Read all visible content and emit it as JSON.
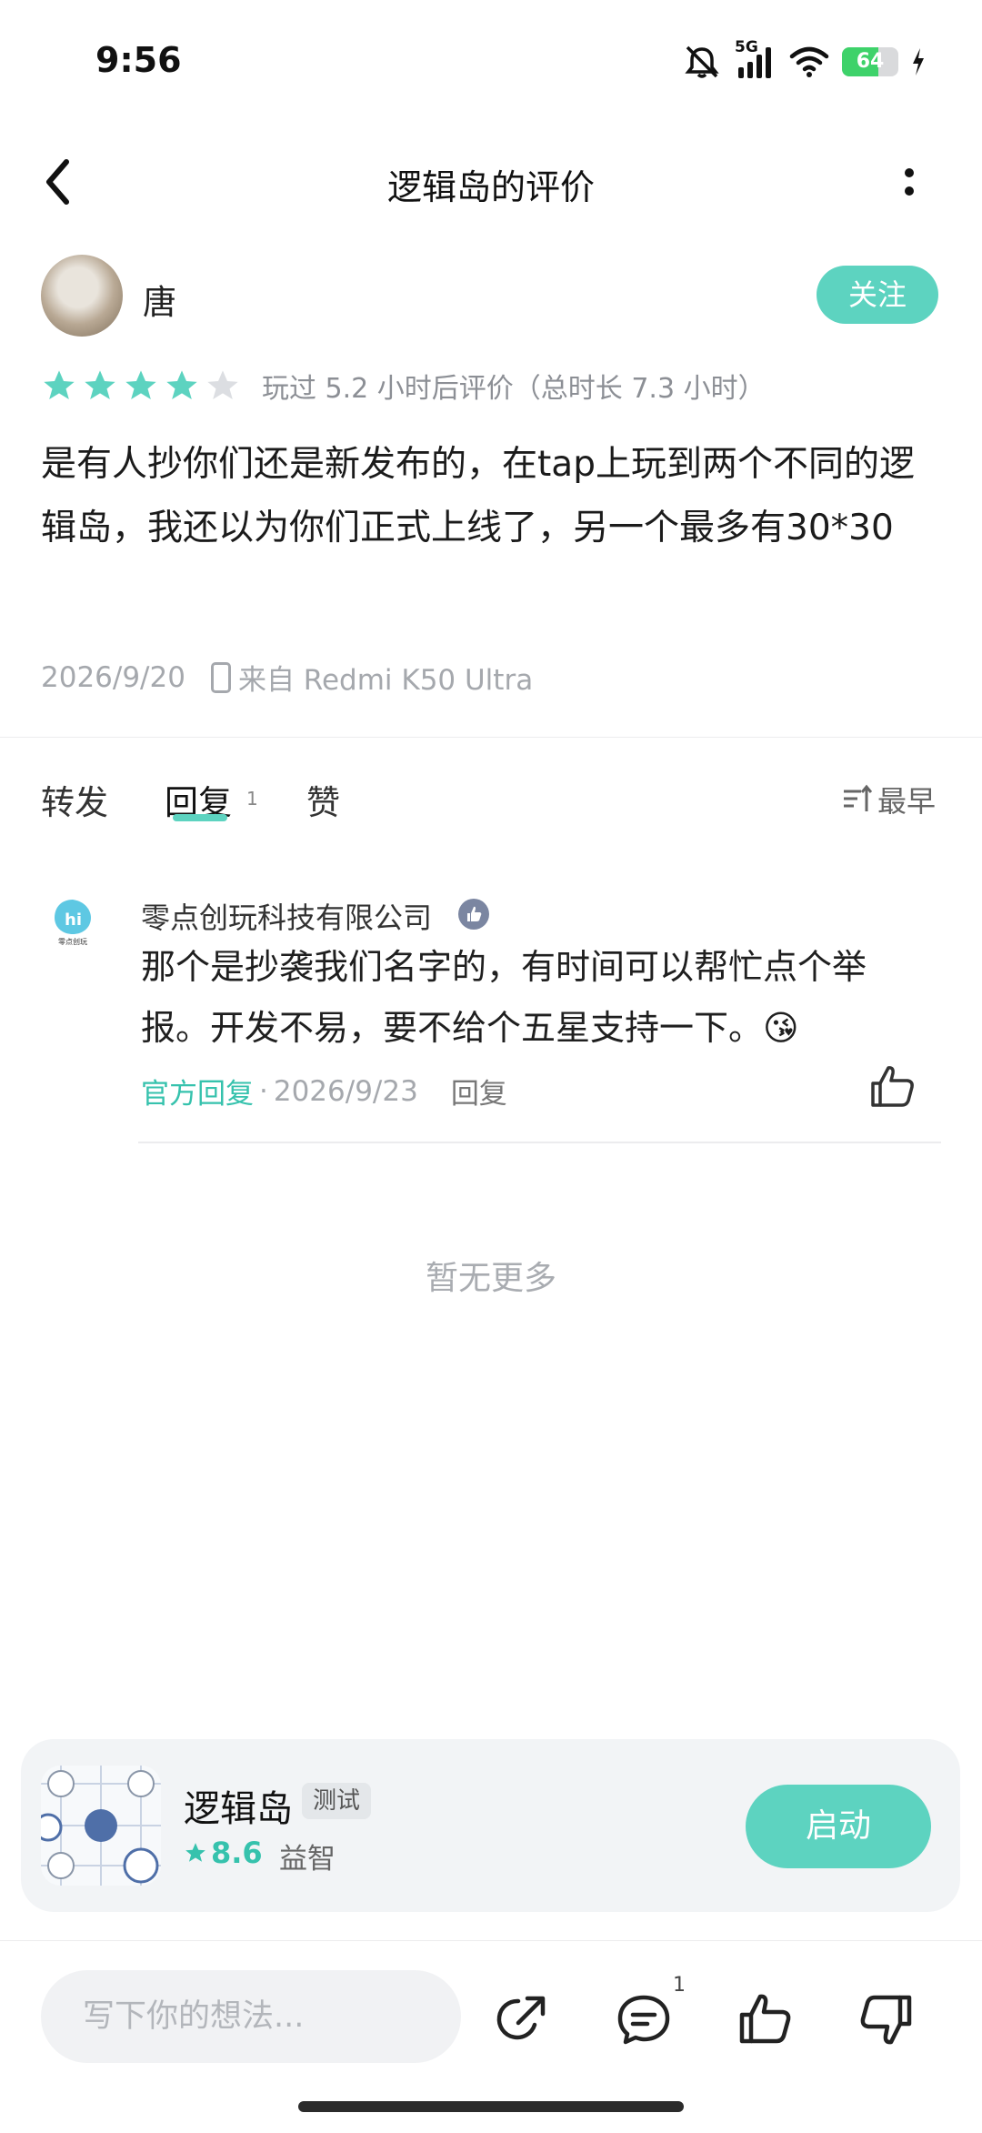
{
  "status_bar": {
    "time": "9:56",
    "network": "5G",
    "battery": "64",
    "battery_level": 0.64,
    "icons": [
      "mute-icon",
      "signal-icon",
      "wifi-icon",
      "battery-icon",
      "charging-icon"
    ]
  },
  "nav": {
    "title": "逻辑岛的评价",
    "back_icon": "chevron-left-icon",
    "more_icon": "more-vertical-icon"
  },
  "review": {
    "author": "唐",
    "follow_label": "关注",
    "rating": 4,
    "max_rating": 5,
    "play_info": "玩过 5.2 小时后评价（总时长 7.3 小时）",
    "text": "是有人抄你们还是新发布的，在tap上玩到两个不同的逻辑岛，我还以为你们正式上线了，另一个最多有30*30",
    "date": "2026/9/20",
    "device": "来自 Redmi K50 Ultra"
  },
  "tabs": {
    "forward": "转发",
    "reply": "回复",
    "reply_count": "1",
    "like": "赞",
    "sort": "最早"
  },
  "reply": {
    "author": "零点创玩科技有限公司",
    "avatar_text": "零点创玩",
    "text": "那个是抄袭我们名字的，有时间可以帮忙点个举报。开发不易，要不给个五星支持一下。😘",
    "official_label": "官方回复",
    "separator": "·",
    "date": "2026/9/23",
    "reply_label": "回复"
  },
  "no_more": "暂无更多",
  "game": {
    "name": "逻辑岛",
    "tag": "测试",
    "rating": "8.6",
    "genre": "益智",
    "launch_label": "启动",
    "accent": "#5dd3c0"
  },
  "bottom_bar": {
    "input_placeholder": "写下你的想法...",
    "comments_badge": "1"
  }
}
